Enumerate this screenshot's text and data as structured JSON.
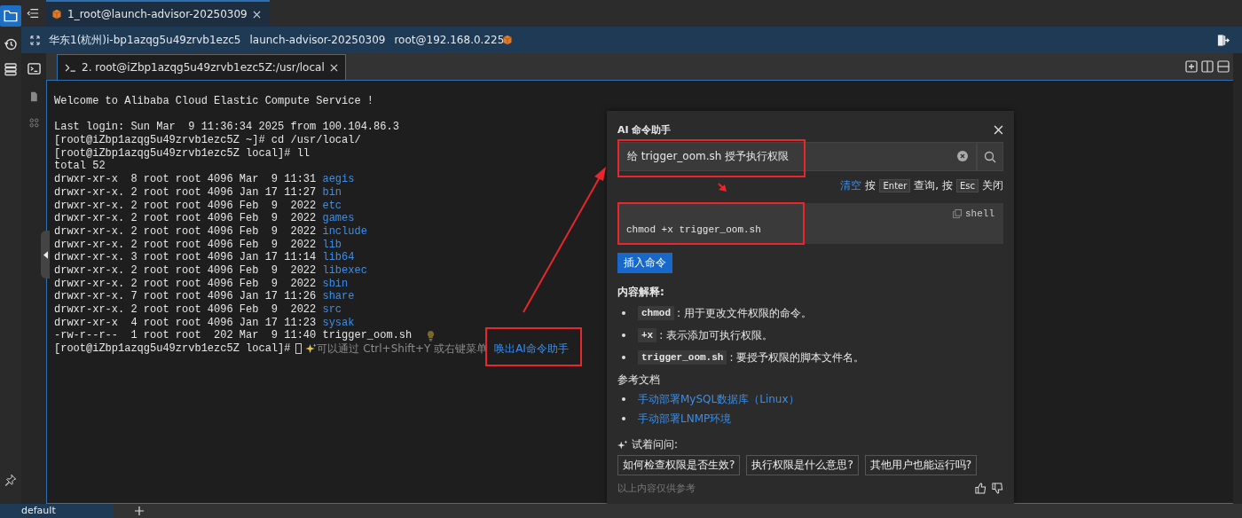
{
  "workspace_tab": {
    "label": "1_root@launch-advisor-20250309",
    "selected": true
  },
  "session_bar": {
    "region": "华东1(杭州)i-bp1azqg5u49zrvb1ezc5",
    "instance": "launch-advisor-20250309",
    "user": "root@192.168.0.225"
  },
  "terminal_tab": {
    "label": "2. root@iZbp1azqg5u49zrvb1ezc5Z:/usr/local",
    "selected": true
  },
  "terminal": {
    "lines": [
      {
        "kind": "text",
        "text": "Welcome to Alibaba Cloud Elastic Compute Service !"
      },
      {
        "kind": "blank"
      },
      {
        "kind": "text",
        "text": "Last login: Sun Mar  9 11:36:34 2025 from 100.104.86.3"
      },
      {
        "kind": "text",
        "text": "[root@iZbp1azqg5u49zrvb1ezc5Z ~]# cd /usr/local/"
      },
      {
        "kind": "text",
        "text": "[root@iZbp1azqg5u49zrvb1ezc5Z local]# ll"
      },
      {
        "kind": "text",
        "text": "total 52"
      },
      {
        "kind": "entry",
        "info": "drwxr-xr-x  8 root root 4096 Mar  9 11:31",
        "name": "aegis",
        "is_dir": true,
        "bulb": false
      },
      {
        "kind": "entry",
        "info": "drwxr-xr-x. 2 root root 4096 Jan 17 11:27",
        "name": "bin",
        "is_dir": true,
        "bulb": false
      },
      {
        "kind": "entry",
        "info": "drwxr-xr-x. 2 root root 4096 Feb  9  2022",
        "name": "etc",
        "is_dir": true,
        "bulb": false
      },
      {
        "kind": "entry",
        "info": "drwxr-xr-x. 2 root root 4096 Feb  9  2022",
        "name": "games",
        "is_dir": true,
        "bulb": false
      },
      {
        "kind": "entry",
        "info": "drwxr-xr-x. 2 root root 4096 Feb  9  2022",
        "name": "include",
        "is_dir": true,
        "bulb": false
      },
      {
        "kind": "entry",
        "info": "drwxr-xr-x. 2 root root 4096 Feb  9  2022",
        "name": "lib",
        "is_dir": true,
        "bulb": false
      },
      {
        "kind": "entry",
        "info": "drwxr-xr-x. 3 root root 4096 Jan 17 11:14",
        "name": "lib64",
        "is_dir": true,
        "bulb": false
      },
      {
        "kind": "entry",
        "info": "drwxr-xr-x. 2 root root 4096 Feb  9  2022",
        "name": "libexec",
        "is_dir": true,
        "bulb": false
      },
      {
        "kind": "entry",
        "info": "drwxr-xr-x. 2 root root 4096 Feb  9  2022",
        "name": "sbin",
        "is_dir": true,
        "bulb": false
      },
      {
        "kind": "entry",
        "info": "drwxr-xr-x. 7 root root 4096 Jan 17 11:26",
        "name": "share",
        "is_dir": true,
        "bulb": false
      },
      {
        "kind": "entry",
        "info": "drwxr-xr-x. 2 root root 4096 Feb  9  2022",
        "name": "src",
        "is_dir": true,
        "bulb": false
      },
      {
        "kind": "entry",
        "info": "drwxr-xr-x  4 root root 4096 Jan 17 11:23",
        "name": "sysak",
        "is_dir": true,
        "bulb": false
      },
      {
        "kind": "entry",
        "info": "-rw-r--r--  1 root root  202 Mar  9 11:40",
        "name": "trigger_oom.sh",
        "is_dir": false,
        "bulb": true
      }
    ],
    "prompt": {
      "text": "[root@iZbp1azqg5u49zrvb1ezc5Z local]#",
      "hint": "可以通过 Ctrl+Shift+Y 或右键菜单",
      "link": "唤出AI命令助手",
      "highlighted": true
    }
  },
  "ai_panel": {
    "title": "AI 命令助手",
    "query": {
      "value": "给 trigger_oom.sh 授予执行权限",
      "highlighted": true
    },
    "hint": [
      {
        "kind": "link",
        "text": "清空"
      },
      {
        "kind": "text",
        "text": "按"
      },
      {
        "kind": "key",
        "text": "Enter"
      },
      {
        "kind": "text",
        "text": "查询, 按"
      },
      {
        "kind": "key",
        "text": "Esc"
      },
      {
        "kind": "text",
        "text": "关闭"
      }
    ],
    "result": {
      "language": "shell",
      "code": "chmod +x trigger_oom.sh",
      "highlighted": true
    },
    "insert_button": "插入命令",
    "explanation": {
      "heading": "内容解释:",
      "items": [
        {
          "code": "chmod",
          "text": ": 用于更改文件权限的命令。"
        },
        {
          "code": "+x",
          "text": ": 表示添加可执行权限。"
        },
        {
          "code": "trigger_oom.sh",
          "text": ": 要授予权限的脚本文件名。"
        }
      ]
    },
    "references": {
      "heading": "参考文档",
      "links": [
        "手动部署MySQL数据库（Linux）",
        "手动部署LNMP环境"
      ]
    },
    "suggestions": {
      "heading": "试着问问:",
      "questions": [
        "如何检查权限是否生效?",
        "执行权限是什么意思?",
        "其他用户也能运行吗?"
      ]
    },
    "footer": "以上内容仅供参考"
  },
  "bottom_tabs": [
    {
      "label": "default",
      "selected": true
    }
  ]
}
